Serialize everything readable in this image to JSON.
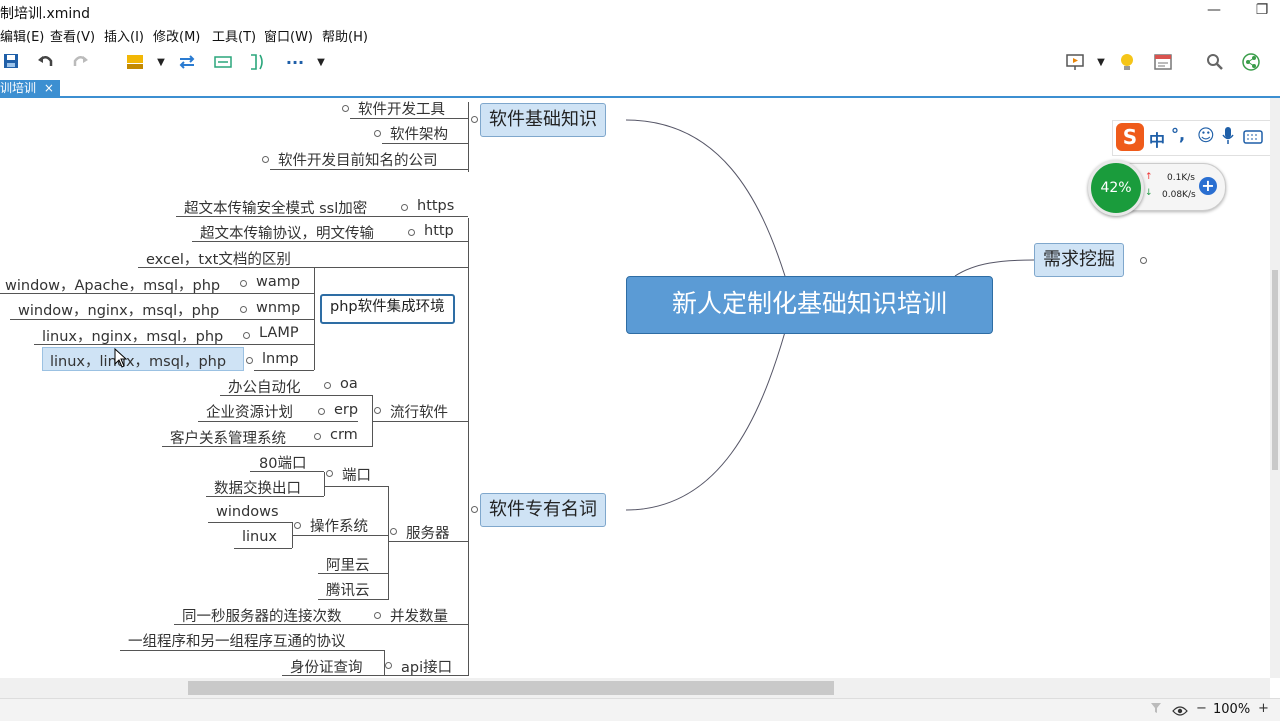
{
  "window": {
    "title": "定制培训.xmind",
    "title_visible": "制培训.xmind",
    "minimize": "—",
    "restore": "❐"
  },
  "menu": [
    "编辑(E)",
    "查看(V)",
    "插入(I)",
    "修改(M)",
    "工具(T)",
    "窗口(W)",
    "帮助(H)"
  ],
  "toolbar": {
    "more": "···"
  },
  "tab": {
    "label": "训培训",
    "close": "×"
  },
  "mindmap": {
    "central": "新人定制化基础知识培训",
    "demand": "需求挖掘",
    "basics": {
      "title": "软件基础知识",
      "items": [
        "软件开发工具",
        "软件架构",
        "软件开发目前知名的公司"
      ]
    },
    "terms": {
      "title": "软件专有名词",
      "https": "https",
      "https_desc": "超文本传输安全模式 ssl加密",
      "http": "http",
      "http_desc": "超文本传输协议，明文传输",
      "excel_txt": "excel，txt文档的区别",
      "php_env": "php软件集成环境",
      "wamp": "wamp",
      "wamp_desc": "window，Apache，msql，php",
      "wnmp": "wnmp",
      "wnmp_desc": "window，nginx，msql，php",
      "lamp": "LAMP",
      "lamp_desc": "linux，nginx，msql，php",
      "lnmp": "lnmp",
      "lnmp_desc": "linux，linux，msql，php",
      "popular": "流行软件",
      "oa": "oa",
      "oa_desc": "办公自动化",
      "erp": "erp",
      "erp_desc": "企业资源计划",
      "crm": "crm",
      "crm_desc": "客户关系管理系统",
      "server": "服务器",
      "port": "端口",
      "port80": "80端口",
      "port_data": "数据交换出口",
      "os": "操作系统",
      "windows": "windows",
      "linux": "linux",
      "aliyun": "阿里云",
      "tencent": "腾讯云",
      "concurrency": "并发数量",
      "concurrency_desc": "同一秒服务器的连接次数",
      "protocol_desc": "一组程序和另一组程序互通的协议",
      "api": "api接口",
      "api_desc": "身份证查询"
    }
  },
  "overlay": {
    "sogou": {
      "logo": "S",
      "items": [
        "中",
        "°,",
        "☺",
        "🎤",
        "⌨"
      ]
    },
    "net": {
      "percent": "42%",
      "up": "0.1K/s",
      "down": "0.08K/s"
    }
  },
  "status": {
    "zoom": "100%",
    "minus": "−",
    "plus": "+"
  }
}
